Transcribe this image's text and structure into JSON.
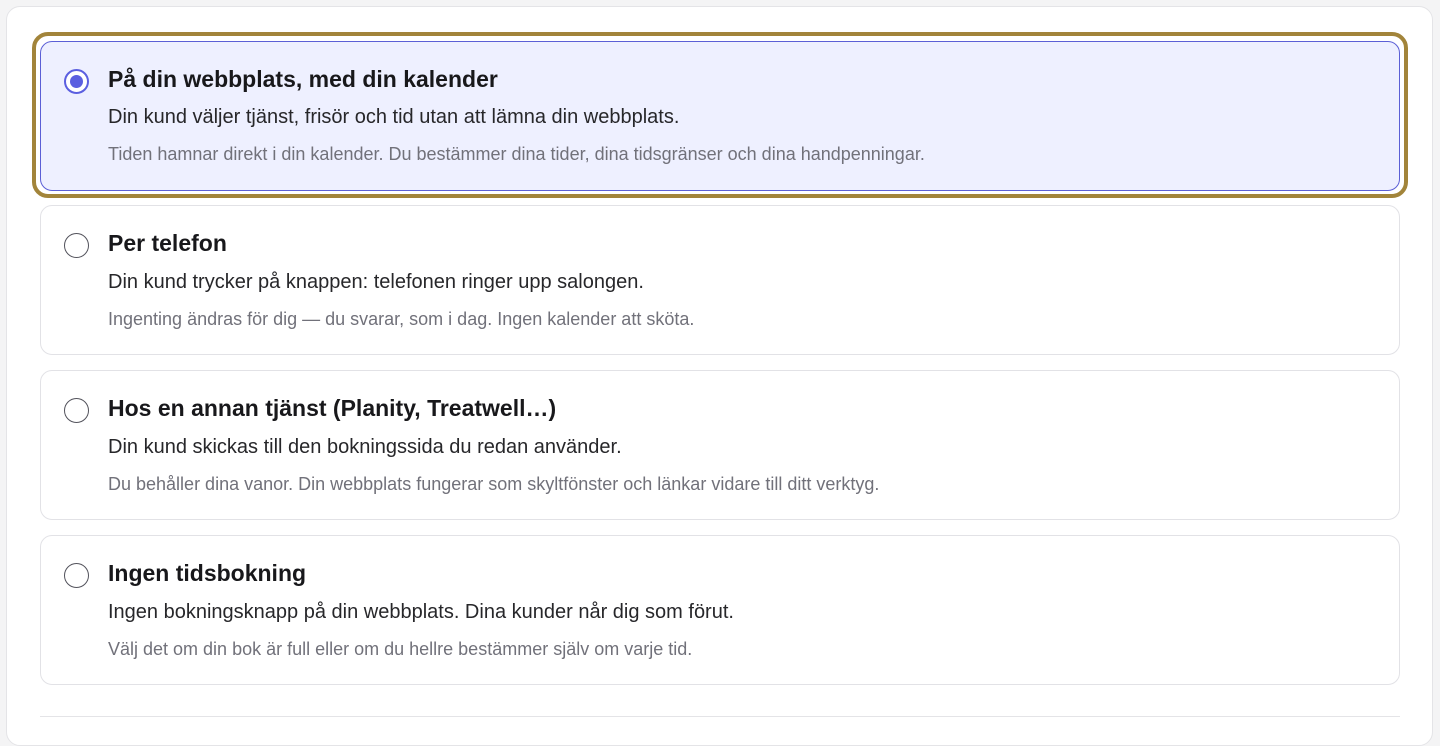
{
  "booking_options": [
    {
      "title": "På din webbplats, med din kalender",
      "description": "Din kund väljer tjänst, frisör och tid utan att lämna din webbplats.",
      "note": "Tiden hamnar direkt i din kalender. Du bestämmer dina tider, dina tidsgränser och dina handpenningar.",
      "selected": true
    },
    {
      "title": "Per telefon",
      "description": "Din kund trycker på knappen: telefonen ringer upp salongen.",
      "note": "Ingenting ändras för dig — du svarar, som i dag. Ingen kalender att sköta.",
      "selected": false
    },
    {
      "title": "Hos en annan tjänst (Planity, Treatwell…)",
      "description": "Din kund skickas till den bokningssida du redan använder.",
      "note": "Du behåller dina vanor. Din webbplats fungerar som skyltfönster och länkar vidare till ditt verktyg.",
      "selected": false
    },
    {
      "title": "Ingen tidsbokning",
      "description": "Ingen bokningsknapp på din webbplats. Dina kunder når dig som förut.",
      "note": "Välj det om din bok är full eller om du hellre bestämmer själv om varje tid.",
      "selected": false
    }
  ],
  "colors": {
    "accent": "#5b5fe0",
    "selected_background": "#eef0ff",
    "focus_ring": "#a2843a"
  }
}
